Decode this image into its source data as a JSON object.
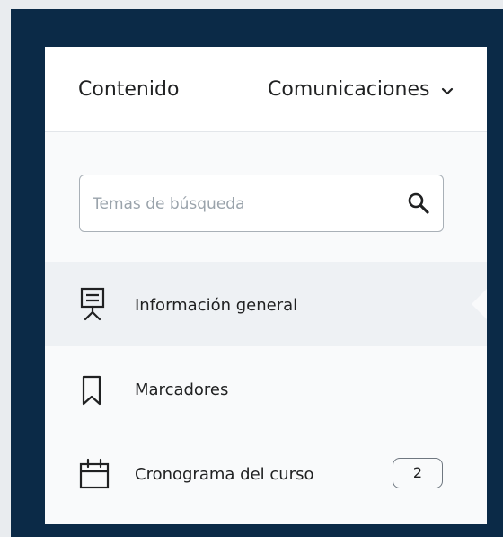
{
  "topnav": {
    "items": [
      {
        "label": "Contenido"
      },
      {
        "label": "Comunicaciones",
        "icon": "chevron-down-icon"
      }
    ]
  },
  "search": {
    "placeholder": "Temas de búsqueda",
    "value": "",
    "icon": "search-icon"
  },
  "sidebar": {
    "items": [
      {
        "label": "Información general",
        "icon": "presentation-icon",
        "active": true
      },
      {
        "label": "Marcadores",
        "icon": "bookmark-icon"
      },
      {
        "label": "Cronograma del curso",
        "icon": "calendar-icon",
        "badge": "2"
      }
    ]
  },
  "colors": {
    "frame": "#0b2a47",
    "active_row": "#eef1f4",
    "text": "#202122"
  }
}
